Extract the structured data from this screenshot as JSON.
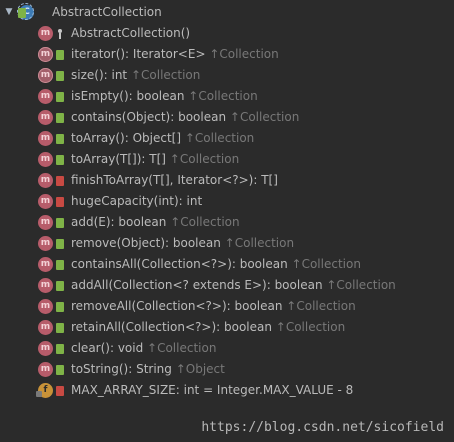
{
  "tree": {
    "expand_icon": "triangle-down-icon",
    "class_icon": "abstract-class-icon",
    "class_visibility_icon": "public-visibility-icon",
    "class_name": "AbstractCollection",
    "members": [
      {
        "icon": "method-icon",
        "visibility": "package",
        "signature": "AbstractCollection()",
        "suffix": ""
      },
      {
        "icon": "abstract-method-icon",
        "visibility": "public",
        "signature": "iterator(): Iterator<E>",
        "suffix": " ↑Collection"
      },
      {
        "icon": "abstract-method-icon",
        "visibility": "public",
        "signature": "size(): int",
        "suffix": " ↑Collection"
      },
      {
        "icon": "method-icon",
        "visibility": "public",
        "signature": "isEmpty(): boolean",
        "suffix": " ↑Collection"
      },
      {
        "icon": "method-icon",
        "visibility": "public",
        "signature": "contains(Object): boolean",
        "suffix": " ↑Collection"
      },
      {
        "icon": "method-icon",
        "visibility": "public",
        "signature": "toArray(): Object[]",
        "suffix": " ↑Collection"
      },
      {
        "icon": "method-icon",
        "visibility": "public",
        "signature": "toArray(T[]): T[]",
        "suffix": " ↑Collection"
      },
      {
        "icon": "method-icon",
        "visibility": "private",
        "signature": "finishToArray(T[], Iterator<?>): T[]",
        "suffix": ""
      },
      {
        "icon": "method-icon",
        "visibility": "private",
        "signature": "hugeCapacity(int): int",
        "suffix": ""
      },
      {
        "icon": "method-icon",
        "visibility": "public",
        "signature": "add(E): boolean",
        "suffix": " ↑Collection"
      },
      {
        "icon": "method-icon",
        "visibility": "public",
        "signature": "remove(Object): boolean",
        "suffix": " ↑Collection"
      },
      {
        "icon": "method-icon",
        "visibility": "public",
        "signature": "containsAll(Collection<?>): boolean",
        "suffix": " ↑Collection"
      },
      {
        "icon": "method-icon",
        "visibility": "public",
        "signature": "addAll(Collection<? extends E>): boolean",
        "suffix": " ↑Collection"
      },
      {
        "icon": "method-icon",
        "visibility": "public",
        "signature": "removeAll(Collection<?>): boolean",
        "suffix": " ↑Collection"
      },
      {
        "icon": "method-icon",
        "visibility": "public",
        "signature": "retainAll(Collection<?>): boolean",
        "suffix": " ↑Collection"
      },
      {
        "icon": "method-icon",
        "visibility": "public",
        "signature": "clear(): void",
        "suffix": " ↑Collection"
      },
      {
        "icon": "method-icon",
        "visibility": "public",
        "signature": "toString(): String",
        "suffix": " ↑Object"
      },
      {
        "icon": "field-icon",
        "visibility": "private",
        "signature": "MAX_ARRAY_SIZE: int = Integer.MAX_VALUE - 8",
        "suffix": ""
      }
    ]
  },
  "watermark": "https://blog.csdn.net/sicofield",
  "colors": {
    "background": "#2b2b2b",
    "text": "#bbbbbb",
    "suffix_text": "#787878",
    "method_icon": "#b75c6a",
    "field_icon": "#c89238",
    "public_visibility": "#7fb347",
    "private_visibility": "#c84a43"
  }
}
